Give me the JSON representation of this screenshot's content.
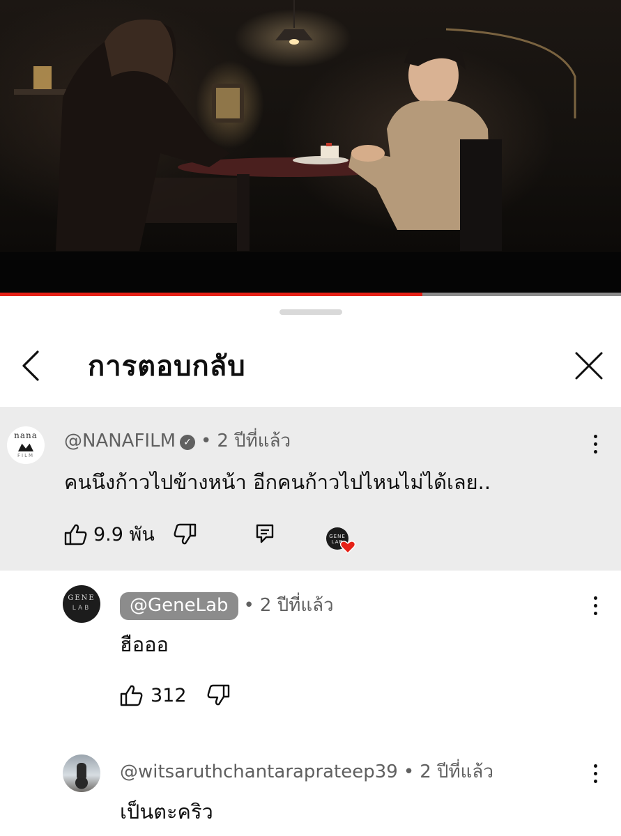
{
  "video": {
    "progress_fraction": 0.68
  },
  "sheet": {
    "title": "การตอบกลับ"
  },
  "top_comment": {
    "author": "@NANAFILM",
    "avatar_text": "nana",
    "avatar_sub": "FILM",
    "separator": "•",
    "time": "2 ปีที่แล้ว",
    "text": "คนนึงก้าวไปข้างหน้า อีกคนก้าวไปไหนไม่ได้เลย..",
    "likes": "9.9 พัน",
    "creator_avatar_text": "GENE LAB",
    "icons": [
      "thumb-up-icon",
      "thumb-down-icon",
      "reply-icon",
      "creator-heart-icon",
      "more-vert-icon",
      "verified-check-icon"
    ]
  },
  "replies": [
    {
      "author": "@GeneLab",
      "avatar_text_top": "GENE",
      "avatar_text_bottom": "LAB",
      "separator": "•",
      "time": "2 ปีที่แล้ว",
      "text": "ฮือออ",
      "likes": "312"
    },
    {
      "author": "@witsaruthchantaraprateep39",
      "separator": "•",
      "time": "2 ปีที่แล้ว",
      "text": "เป็นตะคริว"
    }
  ],
  "colors": {
    "accent_red": "#e62117",
    "highlight_bg": "#ececec",
    "meta_gray": "#606060",
    "pill_bg": "#8c8c8c"
  }
}
